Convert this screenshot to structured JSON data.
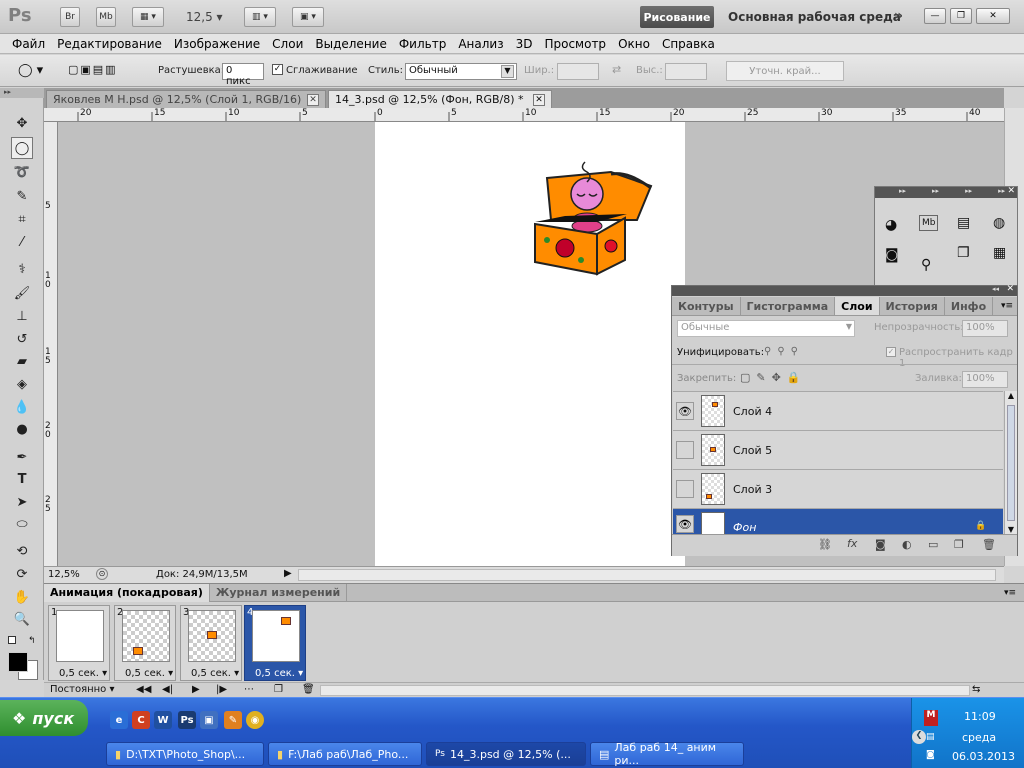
{
  "app": {
    "logo": "Ps",
    "bridge": "Br",
    "mini_bridge": "Mb",
    "zoom": "12,5",
    "workspace_active": "Рисование",
    "workspace_main": "Основная рабочая среда"
  },
  "menu": [
    "Файл",
    "Редактирование",
    "Изображение",
    "Слои",
    "Выделение",
    "Фильтр",
    "Анализ",
    "3D",
    "Просмотр",
    "Окно",
    "Справка"
  ],
  "options": {
    "feather_label": "Растушевка:",
    "feather_value": "0 пикс",
    "antialias_label": "Сглаживание",
    "style_label": "Стиль:",
    "style_value": "Обычный",
    "width_label": "Шир.:",
    "height_label": "Выс.:",
    "refine_edge": "Уточн. край..."
  },
  "tabs": [
    {
      "label": "Яковлев М Н.psd @ 12,5% (Слой 1, RGB/16)"
    },
    {
      "label": "14_3.psd @ 12,5% (Фон, RGB/8) *"
    }
  ],
  "ruler_top": [
    "20",
    "15",
    "10",
    "5",
    "0",
    "5",
    "10",
    "15",
    "20",
    "25",
    "30",
    "35",
    "40"
  ],
  "ruler_left": [
    "5",
    "1 0",
    "1 5",
    "2 0",
    "2 5"
  ],
  "status": {
    "zoom": "12,5%",
    "doc": "Док: 24,9M/13,5M"
  },
  "layers_panel": {
    "tabs": [
      "Контуры",
      "Гистограмма",
      "Слои",
      "История",
      "Инфо"
    ],
    "active_tab": "Слои",
    "blend_mode": "Обычные",
    "opacity_label": "Непрозрачность:",
    "opacity_value": "100%",
    "unify_label": "Унифицировать:",
    "propagate_label": "Распространить кадр 1",
    "lock_label": "Закрепить:",
    "fill_label": "Заливка:",
    "fill_value": "100%",
    "layers": [
      {
        "name": "Слой 4",
        "visible": true
      },
      {
        "name": "Слой 5",
        "visible": false
      },
      {
        "name": "Слой 3",
        "visible": false
      },
      {
        "name": "Фон",
        "visible": true,
        "selected": true
      }
    ]
  },
  "animation": {
    "tabs": [
      "Анимация (покадровая)",
      "Журнал измерений"
    ],
    "frames": [
      {
        "num": "1",
        "delay": "0,5 сек."
      },
      {
        "num": "2",
        "delay": "0,5 сек."
      },
      {
        "num": "3",
        "delay": "0,5 сек."
      },
      {
        "num": "4",
        "delay": "0,5 сек."
      }
    ],
    "loop": "Постоянно"
  },
  "taskbar": {
    "start": "пуск",
    "items": [
      "D:\\TXT\\Photo_Shop\\...",
      "F:\\Лаб раб\\Лаб_Pho...",
      "14_3.psd @ 12,5% (...",
      "Лаб раб 14_ аним ри..."
    ],
    "time": "11:09",
    "day": "среда",
    "date": "06.03.2013"
  },
  "colors": {
    "selected_layer": "#2b56a8",
    "taskbar": "#2457c8",
    "start": "#3a9a3a"
  }
}
